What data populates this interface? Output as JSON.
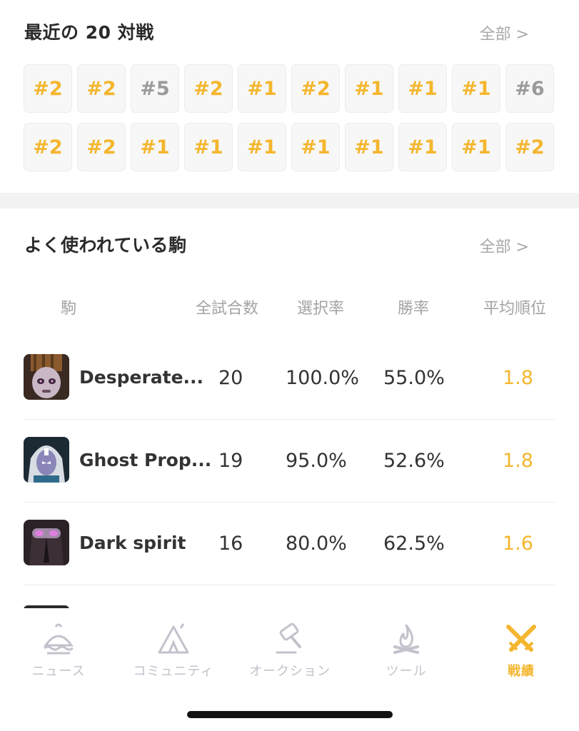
{
  "recent": {
    "title": "最近の 20 対戦",
    "all_label": "全部 >",
    "results": [
      {
        "rank": "#2",
        "color": "#f4b62e"
      },
      {
        "rank": "#2",
        "color": "#f4b62e"
      },
      {
        "rank": "#5",
        "color": "#9a9a9a"
      },
      {
        "rank": "#2",
        "color": "#f4b62e"
      },
      {
        "rank": "#1",
        "color": "#f4b62e"
      },
      {
        "rank": "#2",
        "color": "#f4b62e"
      },
      {
        "rank": "#1",
        "color": "#f4b62e"
      },
      {
        "rank": "#1",
        "color": "#f4b62e"
      },
      {
        "rank": "#1",
        "color": "#f4b62e"
      },
      {
        "rank": "#6",
        "color": "#9a9a9a"
      },
      {
        "rank": "#2",
        "color": "#f4b62e"
      },
      {
        "rank": "#2",
        "color": "#f4b62e"
      },
      {
        "rank": "#1",
        "color": "#f4b62e"
      },
      {
        "rank": "#1",
        "color": "#f4b62e"
      },
      {
        "rank": "#1",
        "color": "#f4b62e"
      },
      {
        "rank": "#1",
        "color": "#f4b62e"
      },
      {
        "rank": "#1",
        "color": "#f4b62e"
      },
      {
        "rank": "#1",
        "color": "#f4b62e"
      },
      {
        "rank": "#1",
        "color": "#f4b62e"
      },
      {
        "rank": "#2",
        "color": "#f4b62e"
      }
    ]
  },
  "units": {
    "title": "よく使われている駒",
    "all_label": "全部 >",
    "headers": {
      "unit": "駒",
      "total": "全試合数",
      "pick_rate": "選択率",
      "win_rate": "勝率",
      "avg_rank": "平均順位"
    },
    "rows": [
      {
        "icon": "desperate-unit-portrait",
        "name": "Desperate...",
        "total": "20",
        "pick_rate": "100.0%",
        "win_rate": "55.0%",
        "avg_rank": "1.8"
      },
      {
        "icon": "ghost-prophet-portrait",
        "name": "Ghost Prop...",
        "total": "19",
        "pick_rate": "95.0%",
        "win_rate": "52.6%",
        "avg_rank": "1.8"
      },
      {
        "icon": "dark-spirit-portrait",
        "name": "Dark spirit",
        "total": "16",
        "pick_rate": "80.0%",
        "win_rate": "62.5%",
        "avg_rank": "1.6"
      }
    ]
  },
  "nav": {
    "items": [
      {
        "label": "ニュース",
        "icon": "island-icon"
      },
      {
        "label": "コミュニティ",
        "icon": "tent-icon"
      },
      {
        "label": "オークション",
        "icon": "hammer-icon"
      },
      {
        "label": "ツール",
        "icon": "campfire-icon"
      },
      {
        "label": "戦績",
        "icon": "crossed-swords-icon",
        "active": true
      }
    ]
  },
  "colors": {
    "accent": "#f4b62e",
    "muted": "#9a9a9a",
    "nav_inactive": "#c2c2cc"
  }
}
